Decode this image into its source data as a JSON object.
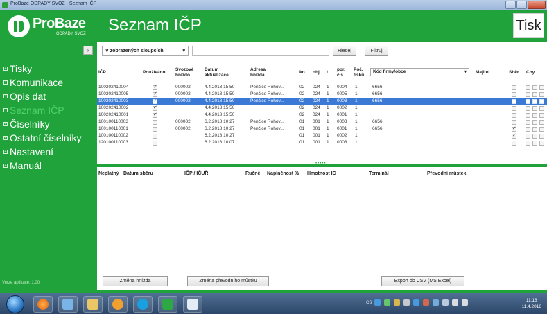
{
  "window": {
    "title": "ProBaze ODPADY SVOZ - Seznam IČP"
  },
  "header": {
    "logo_name": "ProBaze",
    "logo_sub": "ODPADY SVOZ",
    "page_title": "Seznam IČP",
    "print_label": "Tisk"
  },
  "sidebar": {
    "collapse_icon": "«",
    "items": [
      {
        "label": "Tisky",
        "active": false
      },
      {
        "label": "Komunikace",
        "active": false
      },
      {
        "label": "Opis dat",
        "active": false
      },
      {
        "label": "Seznam IČP",
        "active": true
      },
      {
        "label": "Číselníky",
        "active": false
      },
      {
        "label": "Ostatní číselníky",
        "active": false
      },
      {
        "label": "Nastavení",
        "active": false
      },
      {
        "label": "Manuál",
        "active": false
      }
    ],
    "version": "Verze aplikace: 1.00"
  },
  "toolbar": {
    "column_select": "V zobrazených sloupcích",
    "search_value": "",
    "search_button": "Hledej",
    "filter_button": "Filtruj"
  },
  "grid": {
    "headers": {
      "icp": "IČP",
      "pouzivano": "Používáno",
      "svozove_hnizdo_1": "Svozové",
      "svozove_hnizdo_2": "hnízdo",
      "datum_1": "Datum",
      "datum_2": "aktualizace",
      "adresa_1": "Adresa",
      "adresa_2": "hnízda",
      "ko": "ko",
      "obj": "obj",
      "t": "t",
      "por_1": "por.",
      "por_2": "čís.",
      "poc_1": "Poč.",
      "poc_2": "tisků",
      "kod_firmy": "Kód firmy/obce",
      "majitel": "Majitel",
      "sber": "Sběr",
      "chy": "Chy"
    },
    "rows": [
      {
        "icp": "100202410004",
        "pouzivano": true,
        "hnizdo": "000002",
        "datum": "4.4.2018 15:50",
        "adresa": "Penčice Rohov...",
        "ko": "02",
        "obj": "024",
        "t": "1",
        "por": "0004",
        "poc": "1",
        "kod": "6656",
        "sber": false,
        "selected": false
      },
      {
        "icp": "100202410005",
        "pouzivano": true,
        "hnizdo": "000002",
        "datum": "4.4.2018 15:50",
        "adresa": "Penčice Rohov...",
        "ko": "02",
        "obj": "024",
        "t": "1",
        "por": "0005",
        "poc": "1",
        "kod": "6656",
        "sber": false,
        "selected": false
      },
      {
        "icp": "100202410003",
        "pouzivano": true,
        "hnizdo": "000002",
        "datum": "4.4.2018 15:50",
        "adresa": "Penčice Rohov...",
        "ko": "02",
        "obj": "024",
        "t": "1",
        "por": "0003",
        "poc": "1",
        "kod": "6656",
        "sber": false,
        "selected": true
      },
      {
        "icp": "100202410002",
        "pouzivano": true,
        "hnizdo": "",
        "datum": "4.4.2018 15:50",
        "adresa": "",
        "ko": "02",
        "obj": "024",
        "t": "1",
        "por": "0002",
        "poc": "1",
        "kod": "",
        "sber": false,
        "selected": false
      },
      {
        "icp": "100202410001",
        "pouzivano": true,
        "hnizdo": "",
        "datum": "4.4.2018 15:50",
        "adresa": "",
        "ko": "02",
        "obj": "024",
        "t": "1",
        "por": "0001",
        "poc": "1",
        "kod": "",
        "sber": false,
        "selected": false
      },
      {
        "icp": "100100110003",
        "pouzivano": false,
        "hnizdo": "000002",
        "datum": "6.2.2018 10:27",
        "adresa": "Penčice Rohov...",
        "ko": "01",
        "obj": "001",
        "t": "1",
        "por": "0003",
        "poc": "1",
        "kod": "6656",
        "sber": false,
        "selected": false
      },
      {
        "icp": "100100110001",
        "pouzivano": false,
        "hnizdo": "000002",
        "datum": "6.2.2018 10:27",
        "adresa": "Penčice Rohov...",
        "ko": "01",
        "obj": "001",
        "t": "1",
        "por": "0001",
        "poc": "1",
        "kod": "6656",
        "sber": true,
        "selected": false
      },
      {
        "icp": "100100110002",
        "pouzivano": false,
        "hnizdo": "",
        "datum": "6.2.2018 10:27",
        "adresa": "",
        "ko": "01",
        "obj": "001",
        "t": "1",
        "por": "0002",
        "poc": "1",
        "kod": "",
        "sber": true,
        "selected": false
      },
      {
        "icp": "120100110003",
        "pouzivano": false,
        "hnizdo": "",
        "datum": "6.2.2018 10:07",
        "adresa": "",
        "ko": "01",
        "obj": "001",
        "t": "1",
        "por": "0003",
        "poc": "1",
        "kod": "",
        "sber": false,
        "selected": false
      }
    ]
  },
  "detail": {
    "headers": [
      "Neplatný",
      "Datum sběru",
      "IČP / IČUŘ",
      "Ručně",
      "Naplněnost %",
      "Hmotnost IC",
      "Terminál",
      "Převodní můstek"
    ]
  },
  "buttons": {
    "change_nest": "Změna hnízda",
    "change_bridge": "Změna převodního můstku",
    "export_csv": "Export do CSV (MS Excel)"
  },
  "taskbar": {
    "lang": "CS",
    "time": "11:18",
    "date": "11.4.2018"
  }
}
